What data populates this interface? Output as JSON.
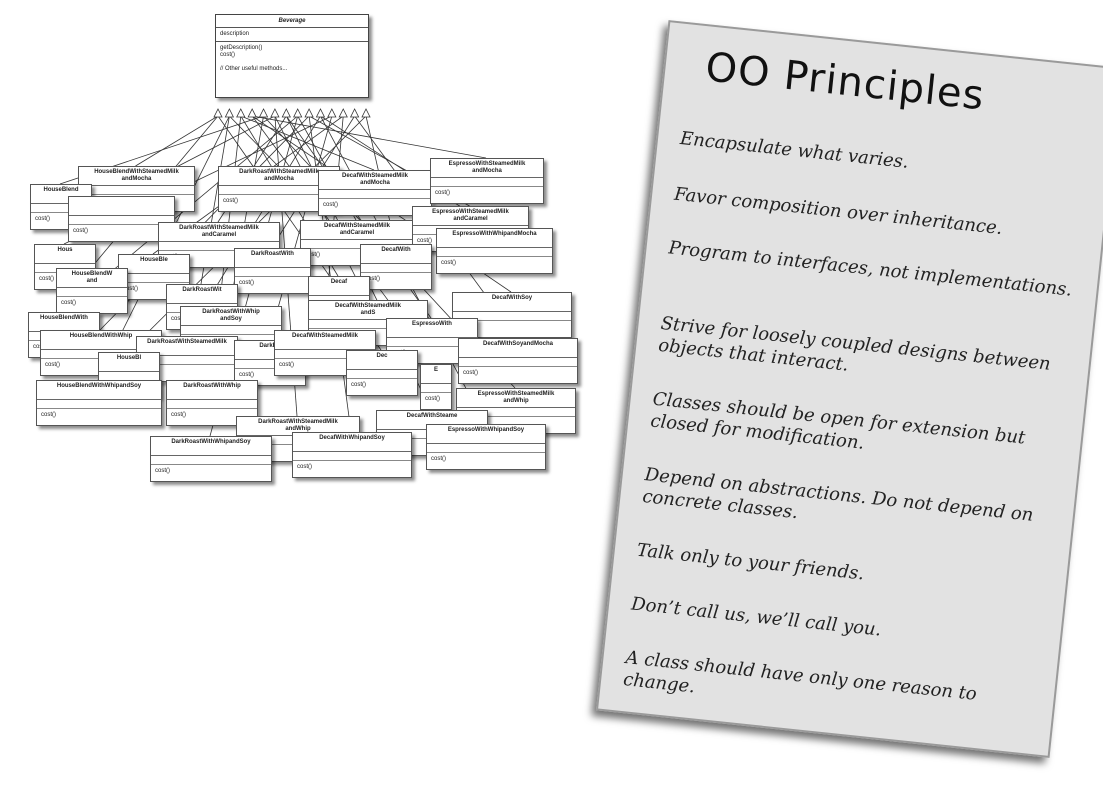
{
  "diagram": {
    "base_class": {
      "name": "Beverage",
      "attributes": [
        "description"
      ],
      "methods": [
        "getDescription()",
        "cost()",
        "",
        "// Other useful methods..."
      ]
    },
    "subclasses": [
      {
        "name": "HouseBlendWithSteamedMilk\nandMocha",
        "method": "cost()"
      },
      {
        "name": "DarkRoastWithSteamedMilk\nandMocha",
        "method": "cost()"
      },
      {
        "name": "DecafWithSteamedMilk\nandMocha",
        "method": "cost()"
      },
      {
        "name": "EspressoWithSteamedMilk\nandMocha",
        "method": "cost()"
      },
      {
        "name": "HouseBlend",
        "method": "cost()"
      },
      {
        "name": "",
        "method": "cost()"
      },
      {
        "name": "DarkRoastWithSteamedMilk\nandCaramel",
        "method": "cost()"
      },
      {
        "name": "DecafWithSteamedMilk\nandCaramel",
        "method": "cost()"
      },
      {
        "name": "EspressoWithSteamedMilk\nandCaramel",
        "method": "cost()"
      },
      {
        "name": "EspressoWithWhipandMocha",
        "method": "cost()"
      },
      {
        "name": "Hous",
        "method": "cost()"
      },
      {
        "name": "HouseBle",
        "method": "cost()"
      },
      {
        "name": "DarkRoastWith",
        "method": "cost()"
      },
      {
        "name": "DecafWith",
        "method": "cost()"
      },
      {
        "name": "HouseBlendW\nand",
        "method": "cost()"
      },
      {
        "name": "DarkRoastWit",
        "method": "cost()"
      },
      {
        "name": "Decaf",
        "method": "cost()"
      },
      {
        "name": "DecafWithSoy",
        "method": "cost()"
      },
      {
        "name": "DarkRoastWithWhip\nandSoy",
        "method": "cost()"
      },
      {
        "name": "DecafWithSteamedMilk\nandS",
        "method": "cost()"
      },
      {
        "name": "EspressoWith",
        "method": "cost()"
      },
      {
        "name": "HouseBlendWith",
        "method": "cost()"
      },
      {
        "name": "HouseBlendWithWhip",
        "method": "cost()"
      },
      {
        "name": "DarkRoastWithSteamedMilk",
        "method": "cost()"
      },
      {
        "name": "DarkRo",
        "method": "cost()"
      },
      {
        "name": "DecafWithSteamedMilk",
        "method": "cost()"
      },
      {
        "name": "DecafWithSoyandMocha",
        "method": "cost()"
      },
      {
        "name": "HouseBl",
        "method": "cost()"
      },
      {
        "name": "Dec",
        "method": "cost()"
      },
      {
        "name": "HouseBlendWithWhipandSoy",
        "method": "cost()"
      },
      {
        "name": "DarkRoastWithWhip",
        "method": "cost()"
      },
      {
        "name": "E",
        "method": "cost()"
      },
      {
        "name": "EspressoWithSteamedMilk\nandWhip",
        "method": "cost()"
      },
      {
        "name": "DarkRoastWithSteamedMilk\nandWhip",
        "method": "cost()"
      },
      {
        "name": "DecafWithSteame",
        "method": "cost()"
      },
      {
        "name": "DarkRoastWithWhipandSoy",
        "method": "cost()"
      },
      {
        "name": "DecafWithWhipandSoy",
        "method": "cost()"
      },
      {
        "name": "EspressoWithWhipandSoy",
        "method": "cost()"
      }
    ]
  },
  "card": {
    "title": "OO Principles",
    "principles": [
      "Encapsulate what varies.",
      "Favor composition over inheritance.",
      "Program to interfaces, not implementations.",
      "Strive for loosely coupled designs between objects that interact.",
      "Classes should be open for extension but closed for modification.",
      "Depend on abstractions. Do not depend on concrete classes.",
      "Talk only to your friends.",
      "Don’t call us, we’ll call you.",
      "A class should have only one reason to change."
    ]
  }
}
